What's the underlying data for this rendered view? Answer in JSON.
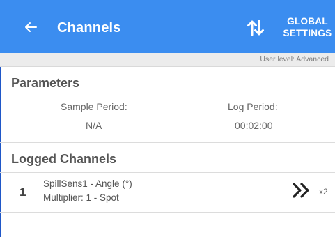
{
  "appbar": {
    "title": "Channels",
    "back_icon": "arrow-left-icon",
    "sort_icon": "sort-arrows-icon",
    "global_settings_line1": "GLOBAL",
    "global_settings_line2": "SETTINGS",
    "background": "#3b8df0"
  },
  "user_level": "User level: Advanced",
  "parameters": {
    "title": "Parameters",
    "sample_period_label": "Sample Period:",
    "sample_period_value": "N/A",
    "log_period_label": "Log Period:",
    "log_period_value": "00:02:00"
  },
  "logged_channels": {
    "title": "Logged Channels",
    "items": [
      {
        "index": "1",
        "name": "SpillSens1 - Angle (°)",
        "detail": "Multiplier: 1 - Spot",
        "action_icon": "double-chevron-right-icon",
        "multiplier": "x2"
      }
    ]
  }
}
